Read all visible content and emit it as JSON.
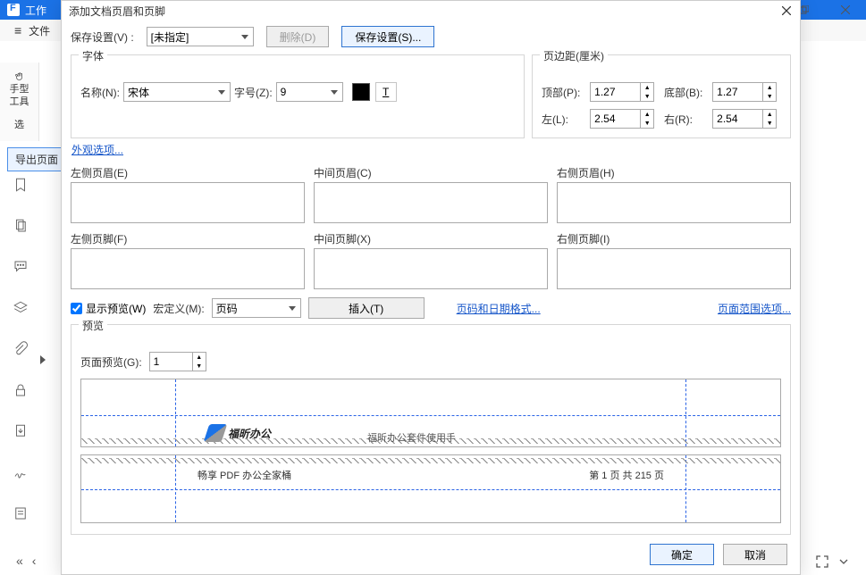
{
  "app": {
    "title_prefix": "工作",
    "menubar_label": "文件",
    "hand_tool_l1": "手型",
    "hand_tool_l2": "工具",
    "select_tool_l1": "选",
    "bg_tab": "导出页面"
  },
  "dialog": {
    "title": "添加文档页眉和页脚",
    "save_label": "保存设置(V) :",
    "save_combo": "[未指定]",
    "delete_btn": "删除(D)",
    "save_btn": "保存设置(S)...",
    "font_group": "字体",
    "font_name_label": "名称(N):",
    "font_name_value": "宋体",
    "font_size_label": "字号(Z):",
    "font_size_value": "9",
    "appearance_link": "外观选项...",
    "margin_group": "页边距(厘米)",
    "margins": {
      "top_label": "顶部(P):",
      "top_value": "1.27",
      "bottom_label": "底部(B):",
      "bottom_value": "1.27",
      "left_label": "左(L):",
      "left_value": "2.54",
      "right_label": "右(R):",
      "right_value": "2.54"
    },
    "hf": {
      "lh_label": "左侧页眉(E)",
      "ch_label": "中间页眉(C)",
      "rh_label": "右侧页眉(H)",
      "lf_label": "左侧页脚(F)",
      "cf_label": "中间页脚(X)",
      "rf_label": "右侧页脚(I)"
    },
    "show_preview_label": "显示预览(W)",
    "macro_label": "宏定义(M):",
    "macro_value": "页码",
    "insert_btn": "插入(T)",
    "page_date_fmt_link": "页码和日期格式...",
    "page_range_link": "页面范围选项...",
    "preview_group": "预览",
    "page_preview_label": "页面预览(G):",
    "page_preview_value": "1",
    "preview_top_tagline": "福昕办公套件使用手",
    "preview_top_logo_text": "福昕办公",
    "preview_bottom_left": "畅享 PDF 办公全家桶",
    "preview_bottom_right": "第 1 页 共 215 页",
    "ok_btn": "确定",
    "cancel_btn": "取消"
  }
}
